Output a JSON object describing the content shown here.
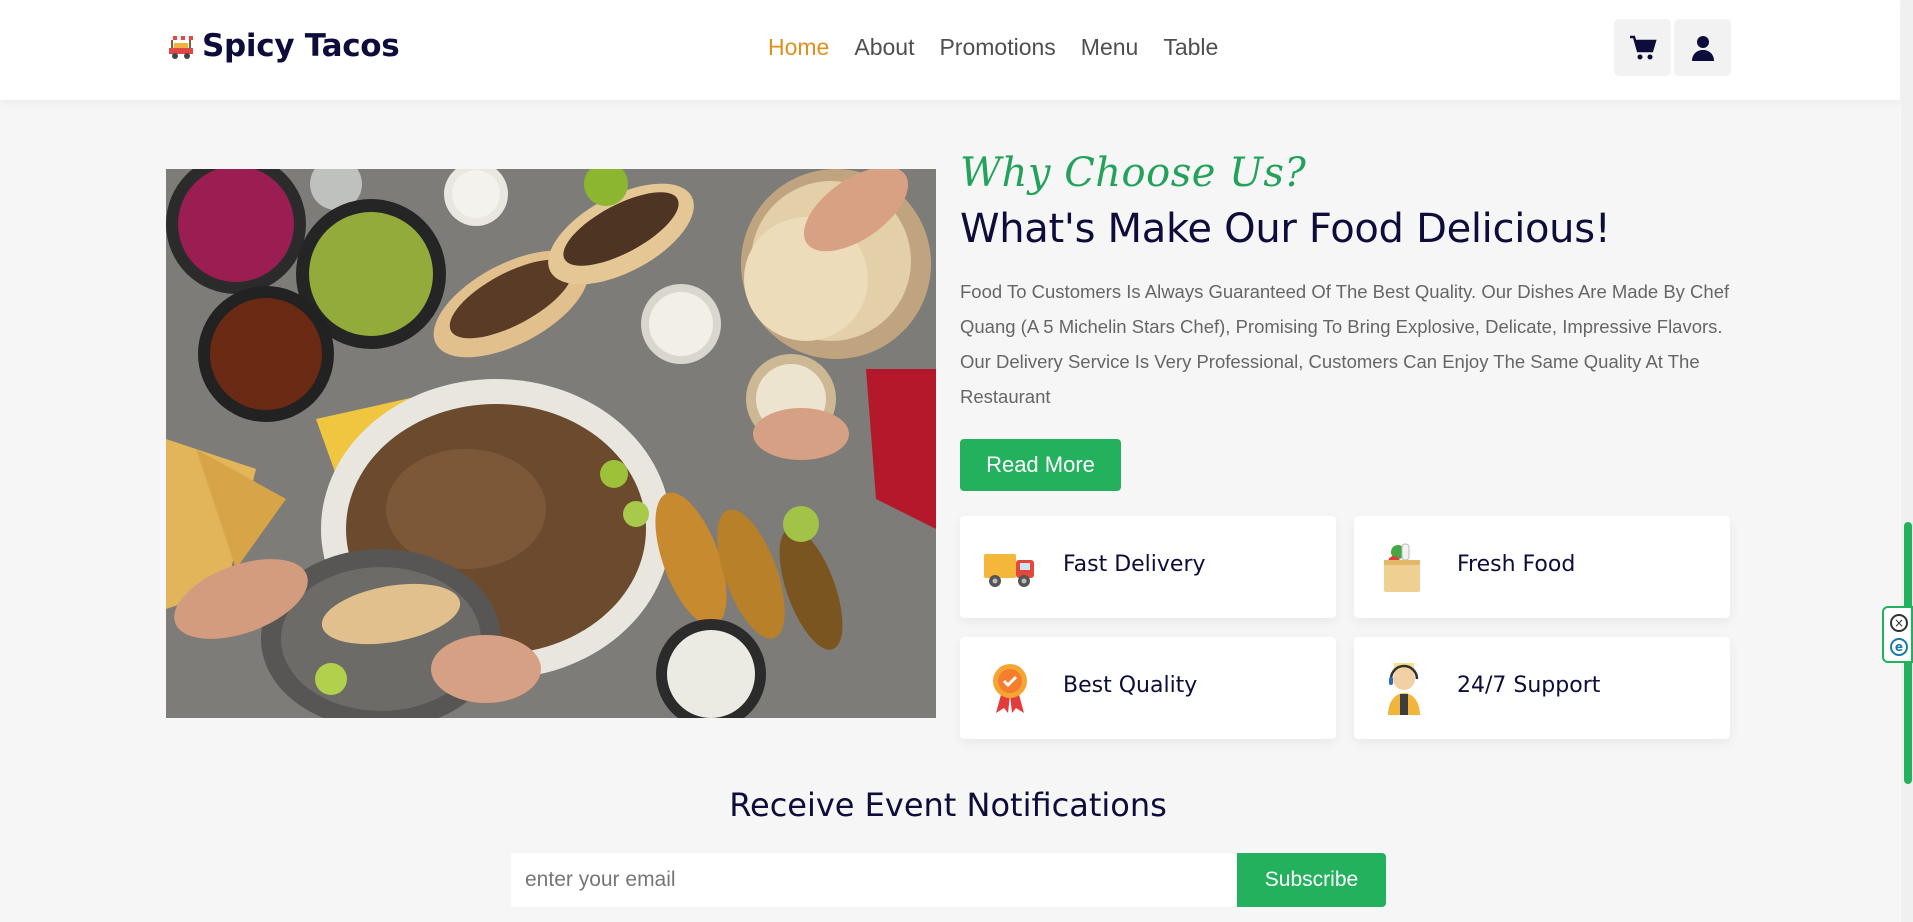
{
  "header": {
    "brand": "Spicy Tacos",
    "nav": [
      {
        "label": "Home",
        "active": true
      },
      {
        "label": "About",
        "active": false
      },
      {
        "label": "Promotions",
        "active": false
      },
      {
        "label": "Menu",
        "active": false
      },
      {
        "label": "Table",
        "active": false
      }
    ],
    "icons": [
      "cart-icon",
      "user-icon"
    ]
  },
  "hero": {
    "image_alt": "food-spread",
    "subtitle": "Why Choose Us?",
    "title": "What's Make Our Food Delicious!",
    "description": "Food To Customers Is Always Guaranteed Of The Best Quality. Our Dishes Are Made By Chef Quang (A 5 Michelin Stars Chef), Promising To Bring Explosive, Delicate, Impressive Flavors. Our Delivery Service Is Very Professional, Customers Can Enjoy The Same Quality At The Restaurant",
    "read_more": "Read More"
  },
  "features": [
    {
      "label": "Fast Delivery",
      "icon": "delivery-truck-icon"
    },
    {
      "label": "Fresh Food",
      "icon": "grocery-bag-icon"
    },
    {
      "label": "Best Quality",
      "icon": "quality-badge-icon"
    },
    {
      "label": "24/7 Support",
      "icon": "support-agent-icon"
    }
  ],
  "newsletter": {
    "title": "Receive Event Notifications",
    "placeholder": "enter your email",
    "button": "Subscribe"
  },
  "colors": {
    "accent_green": "#23b15d",
    "nav_active": "#e0901d",
    "heading_navy": "#0d0c3a"
  }
}
